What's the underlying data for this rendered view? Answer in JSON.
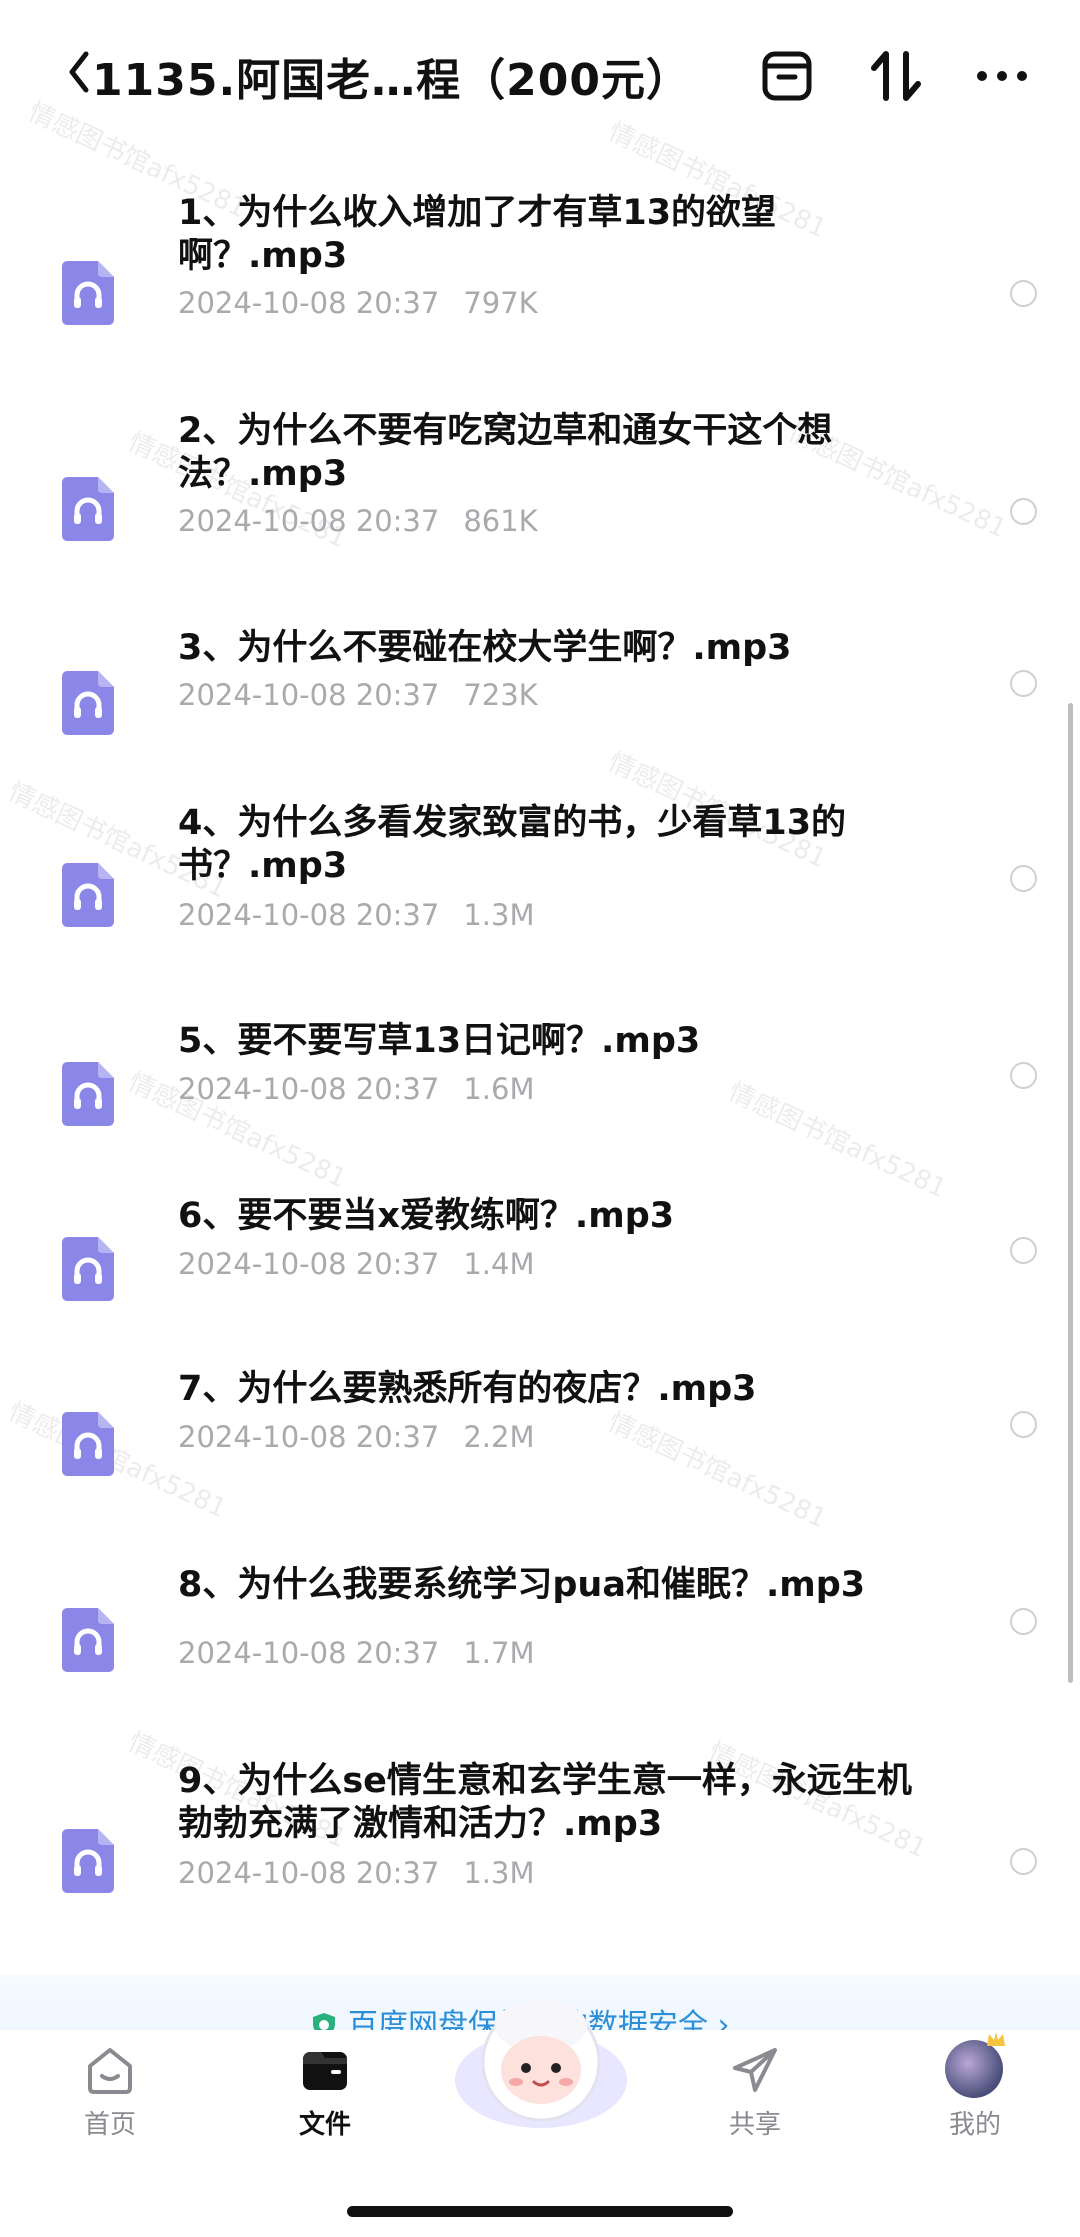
{
  "header": {
    "title": "1135.阿国老…程（200元）",
    "back_icon": "chevron-left-icon",
    "icons": [
      "archive-box-icon",
      "sort-icon",
      "more-icon"
    ]
  },
  "files": [
    {
      "name": "1、为什么收入增加了才有草13的欲望啊？.mp3",
      "date": "2024-10-08 20:37",
      "size": "797K"
    },
    {
      "name": "2、为什么不要有吃窝边草和通女干这个想法？.mp3",
      "date": "2024-10-08 20:37",
      "size": "861K"
    },
    {
      "name": "3、为什么不要碰在校大学生啊？.mp3",
      "date": "2024-10-08 20:37",
      "size": "723K"
    },
    {
      "name": "4、为什么多看发家致富的书，少看草13的书？.mp3",
      "date": "2024-10-08 20:37",
      "size": "1.3M"
    },
    {
      "name": "5、要不要写草13日记啊？.mp3",
      "date": "2024-10-08 20:37",
      "size": "1.6M"
    },
    {
      "name": "6、要不要当x爱教练啊？.mp3",
      "date": "2024-10-08 20:37",
      "size": "1.4M"
    },
    {
      "name": "7、为什么要熟悉所有的夜店？.mp3",
      "date": "2024-10-08 20:37",
      "size": "2.2M"
    },
    {
      "name": "8、为什么我要系统学习pua和催眠？.mp3",
      "date": "2024-10-08 20:37",
      "size": "1.7M"
    },
    {
      "name": "9、为什么se情生意和玄学生意一样，永远生机勃勃充满了激情和活力？.mp3",
      "date": "2024-10-08 20:37",
      "size": "1.3M"
    }
  ],
  "watermark": "情感图书馆afx5281",
  "banner": {
    "text": "百度网盘保护你的数据安全 ›"
  },
  "nav": {
    "home": "首页",
    "files": "文件",
    "share": "共享",
    "mine": "我的"
  },
  "colors": {
    "audio_icon": "#8b87e8",
    "accent": "#2a8fd8"
  }
}
